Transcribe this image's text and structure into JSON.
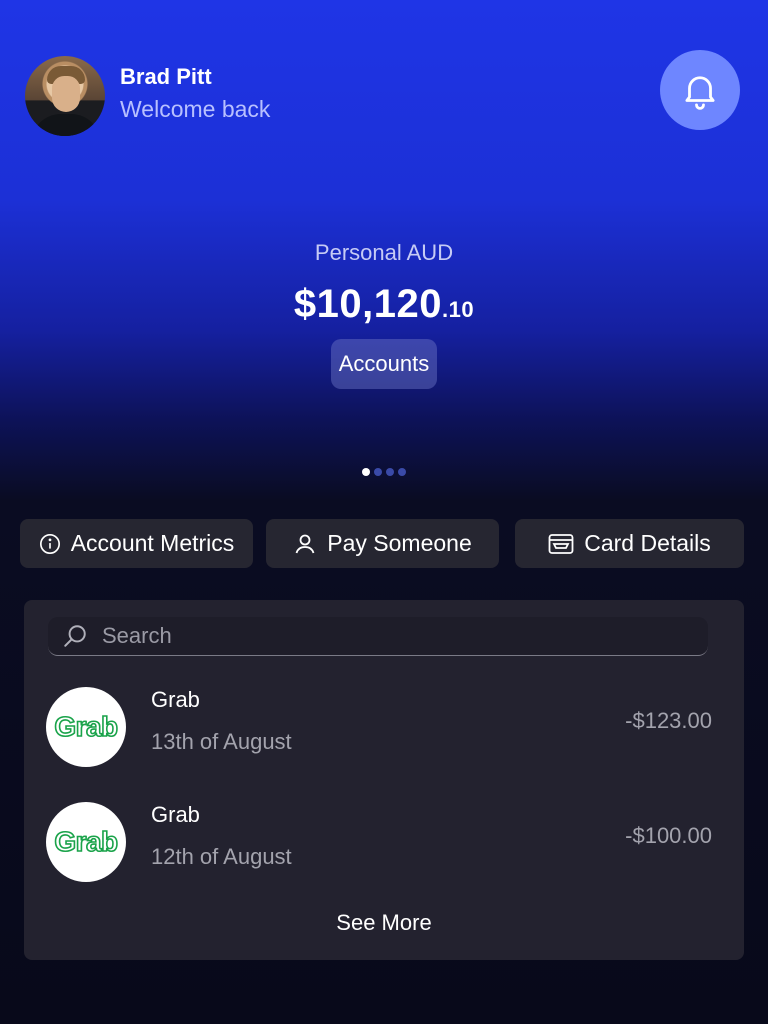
{
  "header": {
    "user_name": "Brad Pitt",
    "welcome": "Welcome back"
  },
  "balance": {
    "account_label": "Personal AUD",
    "amount_main": "$10,120",
    "amount_cents": ".10",
    "accounts_button": "Accounts",
    "page_indicator": {
      "total": 4,
      "active": 1
    }
  },
  "actions": [
    {
      "label": "Account Metrics",
      "icon": "info-icon"
    },
    {
      "label": "Pay Someone",
      "icon": "person-icon"
    },
    {
      "label": "Card Details",
      "icon": "card-icon"
    }
  ],
  "transactions": {
    "search_placeholder": "Search",
    "items": [
      {
        "merchant": "Grab",
        "date": "13th of August",
        "amount": "-$123.00",
        "logo_text": "Grab"
      },
      {
        "merchant": "Grab",
        "date": "12th of August",
        "amount": "-$100.00",
        "logo_text": "Grab"
      }
    ],
    "see_more": "See More"
  },
  "colors": {
    "accent": "#1f35e6",
    "bell_bg": "#6e86ff",
    "panel": "#23222f",
    "grab_green": "#1aa34a"
  }
}
